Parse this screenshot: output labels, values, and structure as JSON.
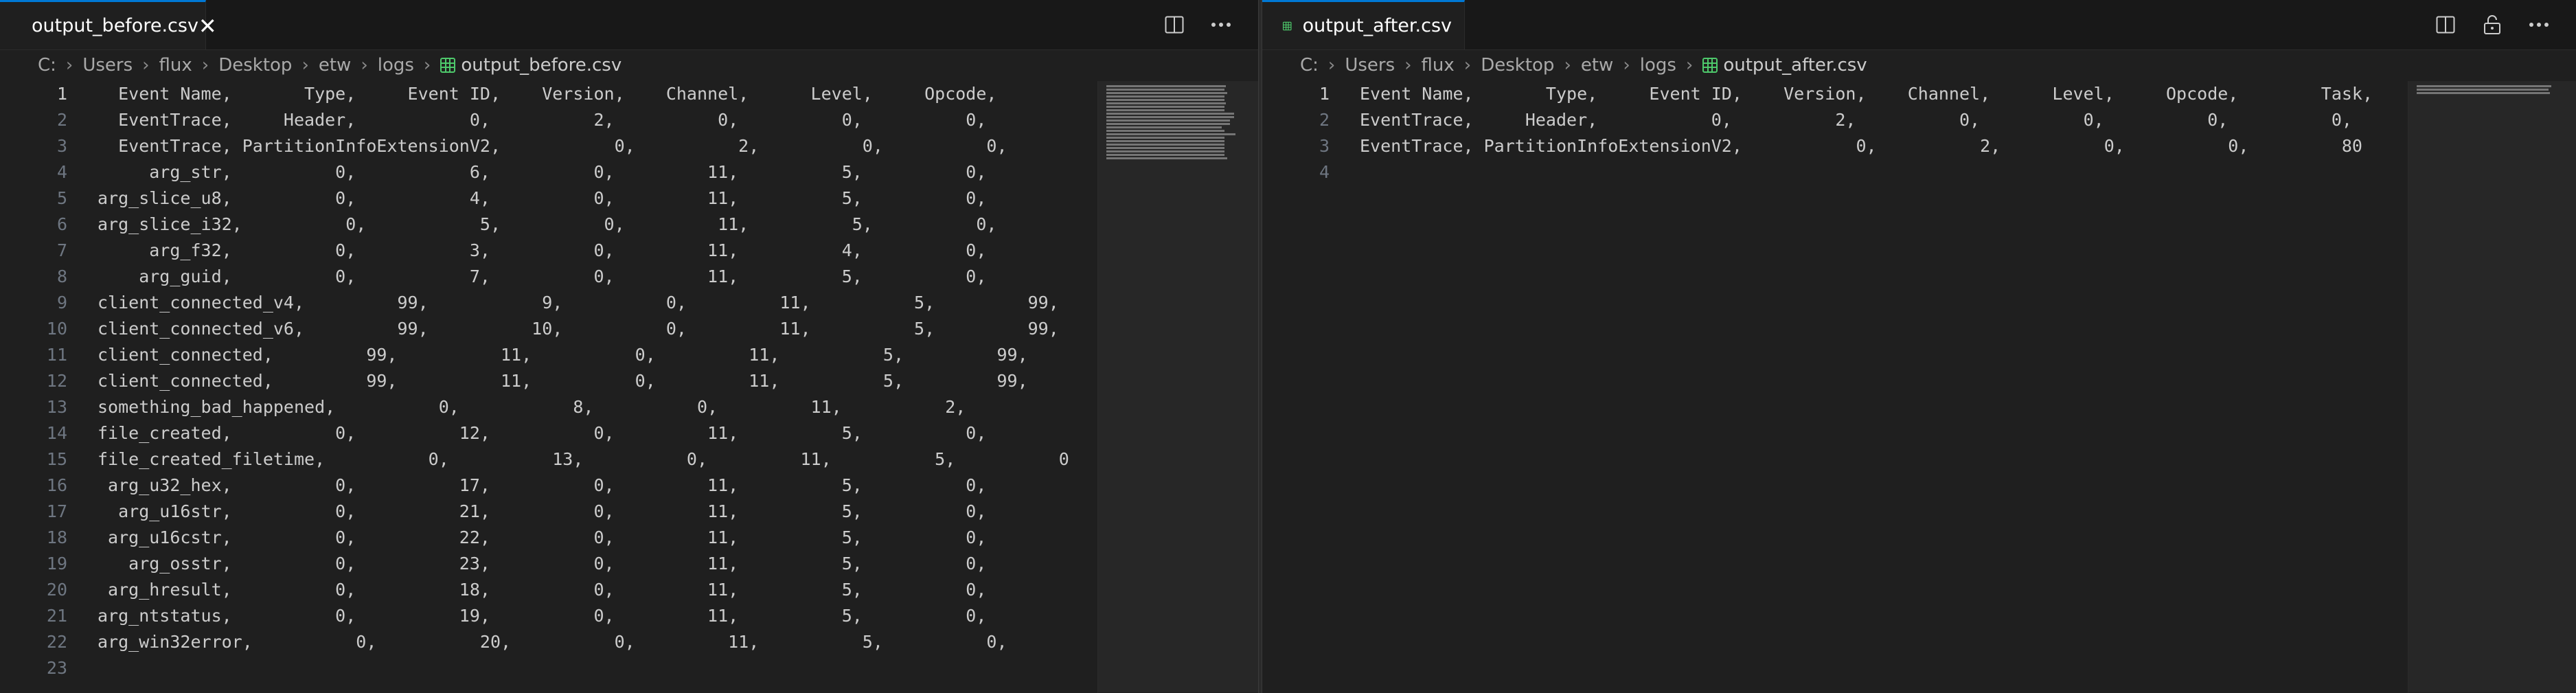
{
  "colors": {
    "accent": "#0078d4",
    "csv_icon": "#4ec96b",
    "editor_bg": "#1f1f1f",
    "tab_bar_bg": "#181818",
    "line_number": "#6e7681",
    "text": "#cccccc"
  },
  "left": {
    "tab": {
      "label": "output_before.csv",
      "icon": "csv-file-icon",
      "close_icon": "close-icon"
    },
    "actions": [
      "split-editor-icon",
      "more-actions-icon"
    ],
    "breadcrumb": [
      "C:",
      "Users",
      "flux",
      "Desktop",
      "etw",
      "logs"
    ],
    "breadcrumb_file": "output_before.csv",
    "active_line": 1,
    "lines": [
      "  Event Name,       Type,     Event ID,    Version,    Channel,      Level,     Opcode,",
      "  EventTrace,     Header,           0,          2,          0,          0,          0,",
      "  EventTrace, PartitionInfoExtensionV2,           0,          2,          0,          0,",
      "     arg_str,          0,           6,          0,         11,          5,          0,",
      "arg_slice_u8,          0,           4,          0,         11,          5,          0,",
      "arg_slice_i32,          0,           5,          0,         11,          5,          0,",
      "     arg_f32,          0,           3,          0,         11,          4,          0,",
      "    arg_guid,          0,           7,          0,         11,          5,          0,",
      "client_connected_v4,         99,           9,          0,         11,          5,         99,",
      "client_connected_v6,         99,          10,          0,         11,          5,         99,",
      "client_connected,         99,          11,          0,         11,          5,         99,",
      "client_connected,         99,          11,          0,         11,          5,         99,",
      "something_bad_happened,          0,           8,          0,         11,          2,",
      "file_created,          0,          12,          0,         11,          5,          0,",
      "file_created_filetime,          0,          13,          0,         11,          5,          0",
      " arg_u32_hex,          0,          17,          0,         11,          5,          0,",
      "  arg_u16str,          0,          21,          0,         11,          5,          0,",
      " arg_u16cstr,          0,          22,          0,         11,          5,          0,",
      "   arg_osstr,          0,          23,          0,         11,          5,          0,",
      " arg_hresult,          0,          18,          0,         11,          5,          0,",
      "arg_ntstatus,          0,          19,          0,         11,          5,          0,",
      "arg_win32error,          0,          20,          0,         11,          5,          0,",
      ""
    ]
  },
  "right": {
    "tab": {
      "label": "output_after.csv",
      "icon": "csv-file-icon"
    },
    "actions": [
      "split-editor-icon",
      "unlock-icon",
      "more-actions-icon"
    ],
    "breadcrumb": [
      "C:",
      "Users",
      "flux",
      "Desktop",
      "etw",
      "logs"
    ],
    "breadcrumb_file": "output_after.csv",
    "active_line": 1,
    "lines": [
      "Event Name,       Type,     Event ID,    Version,    Channel,      Level,     Opcode,        Task,",
      "EventTrace,     Header,           0,          2,          0,          0,          0,          0,",
      "EventTrace, PartitionInfoExtensionV2,           0,          2,          0,          0,         80",
      ""
    ]
  }
}
